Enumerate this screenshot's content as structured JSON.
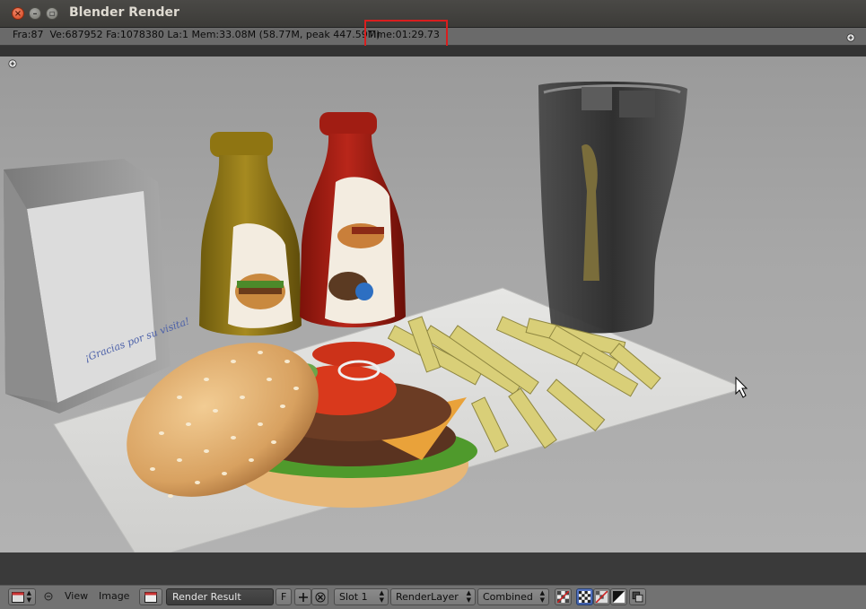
{
  "window": {
    "title": "Blender Render",
    "buttons": [
      "close",
      "minimize",
      "maximize"
    ]
  },
  "render_info": {
    "stats": "Fra:87  Ve:687952 Fa:1078380 La:1 Mem:33.08M (58.77M, peak 447.59M)",
    "time": "Time:01:29.73",
    "highlight_color": "#d91e1e"
  },
  "image_editor": {
    "editor_type_icon": "image-editor-icon",
    "menus": {
      "view": "View",
      "image": "Image"
    },
    "image_name": "Render Result",
    "fake_user": "F",
    "slot": "Slot 1",
    "layer": "RenderLayer",
    "pass": "Combined",
    "display_icons": [
      "checker-icon",
      "color-alpha-icon",
      "alpha-icon",
      "z-buffer-icon",
      "mask-icon"
    ]
  },
  "scene_text": {
    "napkin_script": "¡Gracias por su visita!"
  },
  "colors": {
    "header_bg": "#727272",
    "viewport_bg": "#a7a7a7",
    "accent_red": "#d91e1e"
  }
}
